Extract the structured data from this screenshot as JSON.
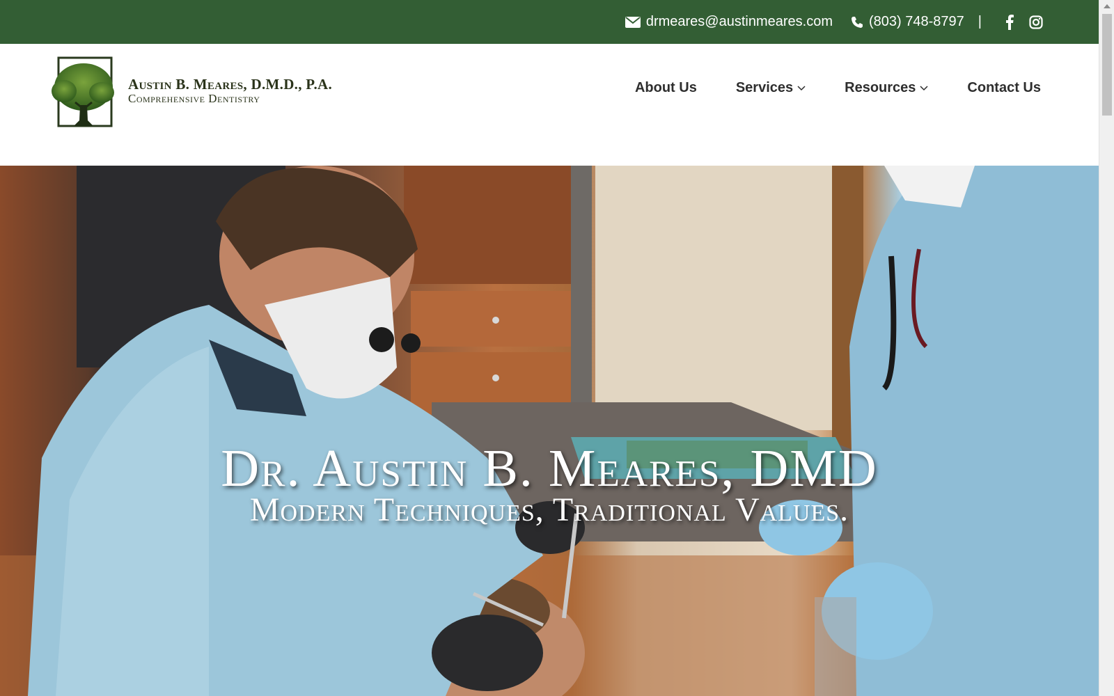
{
  "topbar": {
    "email": "drmeares@austinmeares.com",
    "phone": "(803) 748-8797",
    "separator": "|",
    "social": [
      "facebook-icon",
      "instagram-icon"
    ],
    "background": "#335e34"
  },
  "header": {
    "logo": {
      "name": "Austin B. Meares, D.M.D., P.A.",
      "subtitle": "Comprehensive Dentistry",
      "icon": "tree-icon"
    },
    "nav": [
      {
        "label": "About Us",
        "dropdown": false
      },
      {
        "label": "Services",
        "dropdown": true
      },
      {
        "label": "Resources",
        "dropdown": true
      },
      {
        "label": "Contact Us",
        "dropdown": false
      }
    ]
  },
  "hero": {
    "title": "Dr. Austin B. Meares, DMD",
    "tagline": "Modern Techniques, Traditional Values."
  }
}
